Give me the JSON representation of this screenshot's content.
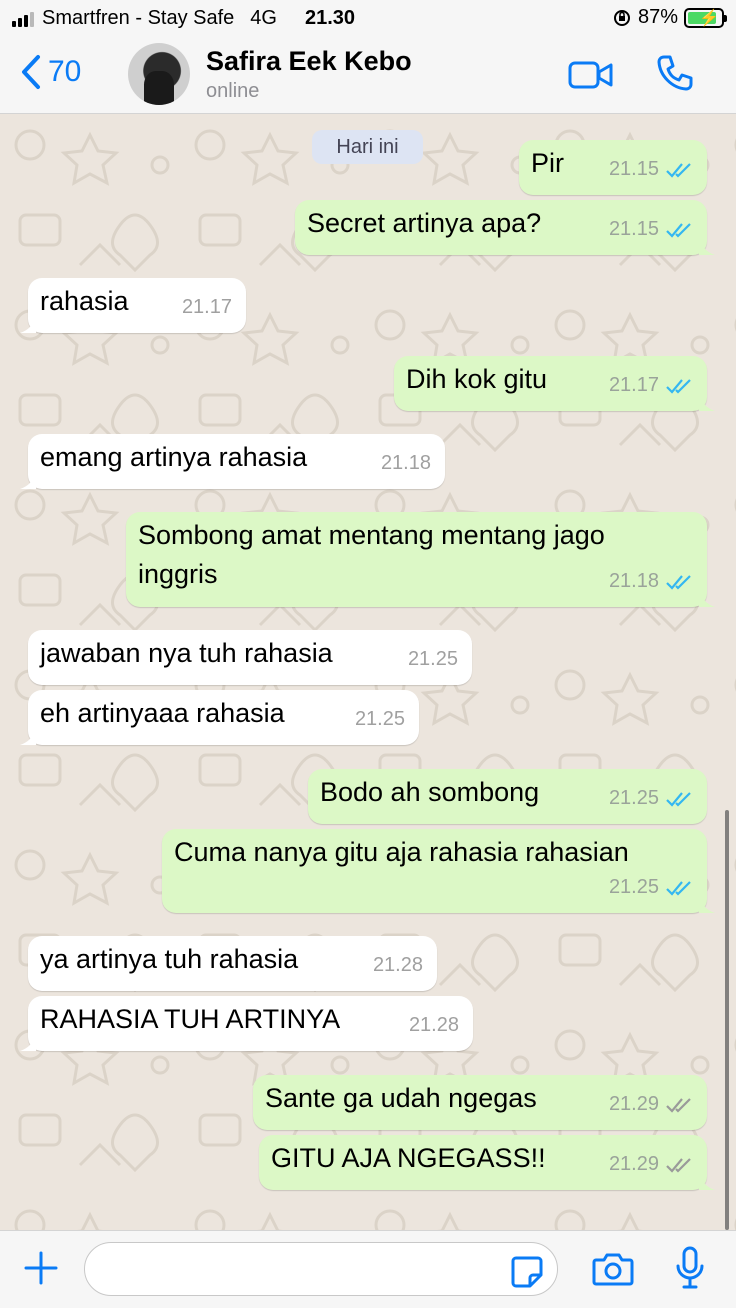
{
  "status_bar": {
    "carrier": "Smartfren - Stay Safe",
    "network": "4G",
    "time": "21.30",
    "battery": "87%"
  },
  "header": {
    "back_count": "70",
    "contact_name": "Safira Eek Kebo",
    "contact_status": "online"
  },
  "date_separator": "Hari ini",
  "messages": [
    {
      "text": "Pir",
      "time": "21.15",
      "direction": "out",
      "status": "read"
    },
    {
      "text": "Secret artinya apa?",
      "time": "21.15",
      "direction": "out",
      "status": "read"
    },
    {
      "text": "rahasia",
      "time": "21.17",
      "direction": "in"
    },
    {
      "text": "Dih kok gitu",
      "time": "21.17",
      "direction": "out",
      "status": "read"
    },
    {
      "text": "emang artinya rahasia",
      "time": "21.18",
      "direction": "in"
    },
    {
      "text": "Sombong amat mentang mentang jago inggris",
      "time": "21.18",
      "direction": "out",
      "status": "read"
    },
    {
      "text": "jawaban nya tuh rahasia",
      "time": "21.25",
      "direction": "in"
    },
    {
      "text": "eh artinyaaa rahasia",
      "time": "21.25",
      "direction": "in"
    },
    {
      "text": "Bodo ah sombong",
      "time": "21.25",
      "direction": "out",
      "status": "read"
    },
    {
      "text": "Cuma nanya gitu aja rahasia rahasian",
      "time": "21.25",
      "direction": "out",
      "status": "read"
    },
    {
      "text": "ya artinya tuh rahasia",
      "time": "21.28",
      "direction": "in"
    },
    {
      "text": "RAHASIA TUH ARTINYA",
      "time": "21.28",
      "direction": "in"
    },
    {
      "text": "Sante ga udah ngegas",
      "time": "21.29",
      "direction": "out",
      "status": "delivered"
    },
    {
      "text": "GITU AJA NGEGASS!!",
      "time": "21.29",
      "direction": "out",
      "status": "delivered"
    }
  ],
  "colors": {
    "outgoing_bubble": "#dcf8c6",
    "incoming_bubble": "#ffffff",
    "read_tick": "#34b7f1",
    "delivered_tick": "#9a9a9a",
    "accent": "#0a7bf5"
  },
  "icons": {
    "back": "chevron-left-icon",
    "video": "video-call-icon",
    "phone": "phone-icon",
    "plus": "plus-icon",
    "sticker": "sticker-icon",
    "camera": "camera-icon",
    "mic": "microphone-icon"
  }
}
